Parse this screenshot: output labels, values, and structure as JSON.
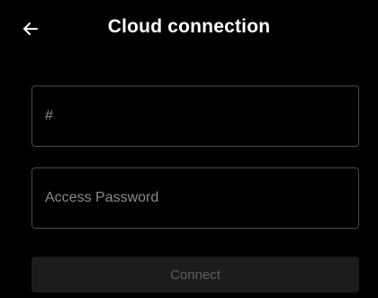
{
  "header": {
    "back_icon": "arrow-left-icon",
    "title": "Cloud connection"
  },
  "form": {
    "id_field": {
      "value": "",
      "placeholder": "#"
    },
    "password_field": {
      "value": "",
      "placeholder": "Access Password"
    },
    "connect_button": {
      "label": "Connect",
      "state": "disabled"
    }
  },
  "colors": {
    "background": "#000000",
    "text": "#ffffff",
    "field_border": "#4a4a4a",
    "placeholder": "#8a8a8a",
    "button_bg_disabled": "#1c1c1c",
    "button_text_disabled": "#5e5e5e"
  }
}
